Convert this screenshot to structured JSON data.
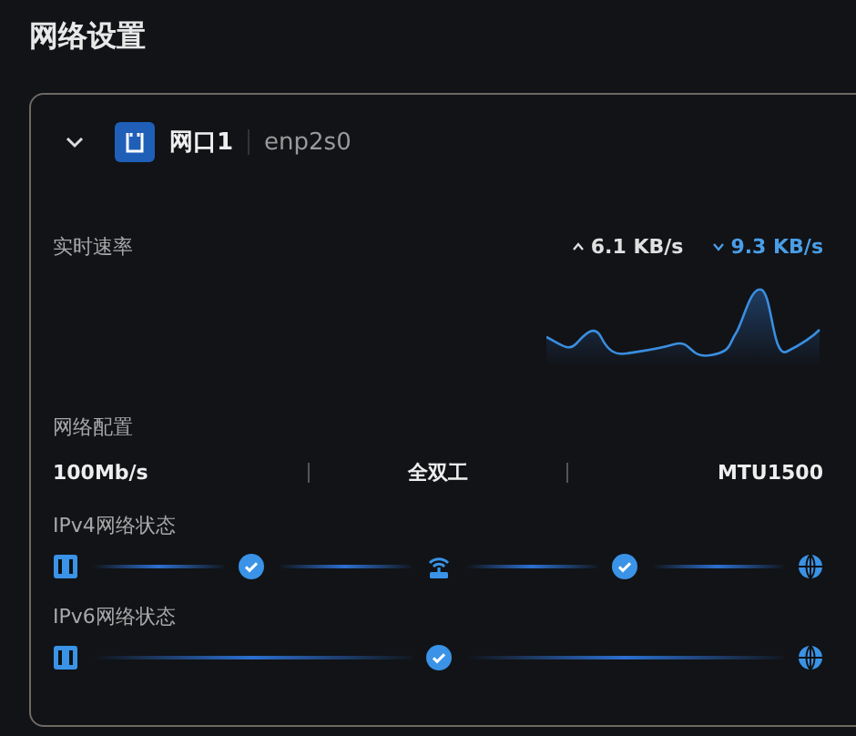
{
  "title": "网络设置",
  "port": {
    "expanded": true,
    "name": "网口1",
    "device": "enp2s0"
  },
  "rate": {
    "label": "实时速率",
    "upload": "6.1 KB/s",
    "download": "9.3 KB/s"
  },
  "config": {
    "label": "网络配置",
    "values": [
      "100Mb/s",
      "全双工",
      "MTU1500"
    ]
  },
  "status": [
    {
      "label": "IPv4网络状态",
      "steps": [
        {
          "kind": "computer"
        },
        {
          "kind": "ok"
        },
        {
          "kind": "router"
        },
        {
          "kind": "ok"
        },
        {
          "kind": "globe"
        }
      ]
    },
    {
      "label": "IPv6网络状态",
      "steps": [
        {
          "kind": "computer"
        },
        {
          "kind": "ok"
        },
        {
          "kind": "globe"
        }
      ]
    }
  ]
}
